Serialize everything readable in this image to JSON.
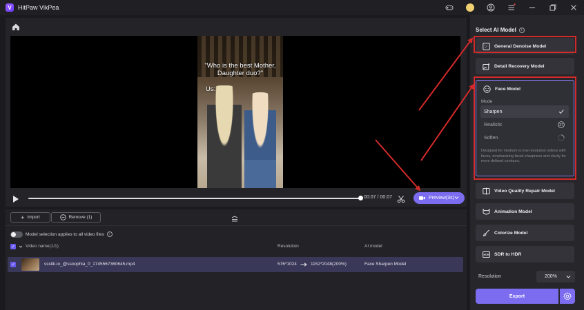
{
  "window": {
    "title": "HitPaw VikPea",
    "icons": [
      "game-controller-icon",
      "avatar",
      "user-icon",
      "menu-icon",
      "minimize-icon",
      "restore-icon",
      "close-icon"
    ]
  },
  "video": {
    "caption_line1": "\"Who is the best Mother,",
    "caption_line2": "Daughter duo?\"",
    "caption_us": "Us:",
    "current_time": "00:07",
    "total_time": "00:07",
    "time_separator": "/",
    "progress": 1.0,
    "preview_label": "Preview(3s)"
  },
  "files": {
    "import_label": "Import",
    "remove_label": "Remove (1)",
    "toggle_label": "Model selection applies to all video files",
    "columns": {
      "name": "Video name(1/1)",
      "resolution": "Resolution",
      "model": "AI model"
    },
    "rows": [
      {
        "name": "ssstik.io_@ssoophia_0_1745567360645.mp4",
        "resolution_from": "576*1024",
        "resolution_to": "1152*2048(200%)",
        "model": "Face Sharpen Model"
      }
    ]
  },
  "models": {
    "title": "Select AI Model",
    "items": [
      {
        "label": "General Denoise Model"
      },
      {
        "label": "Detail Recovery Model"
      },
      {
        "label": "Face Model"
      },
      {
        "label": "Video Quality Repair Model"
      },
      {
        "label": "Animation Model"
      },
      {
        "label": "Colorize Model"
      },
      {
        "label": "SDR to HDR"
      }
    ],
    "face": {
      "mode_label": "Mode",
      "options": [
        {
          "label": "Sharpen",
          "state": "selected"
        },
        {
          "label": "Realistic",
          "state": "badge",
          "badge": "27"
        },
        {
          "label": "Soften",
          "state": "loading"
        }
      ],
      "description": "Designed for medium to low-resolution videos with faces, emphasizing facial sharpness and clarity for more defined contours."
    },
    "resolution_label": "Resolution",
    "resolution_value": "200%",
    "export_label": "Export"
  },
  "colors": {
    "accent": "#7b6cf0",
    "annotation_red": "#d42a2a",
    "panel": "#26262b",
    "background": "#1b1b1f"
  }
}
